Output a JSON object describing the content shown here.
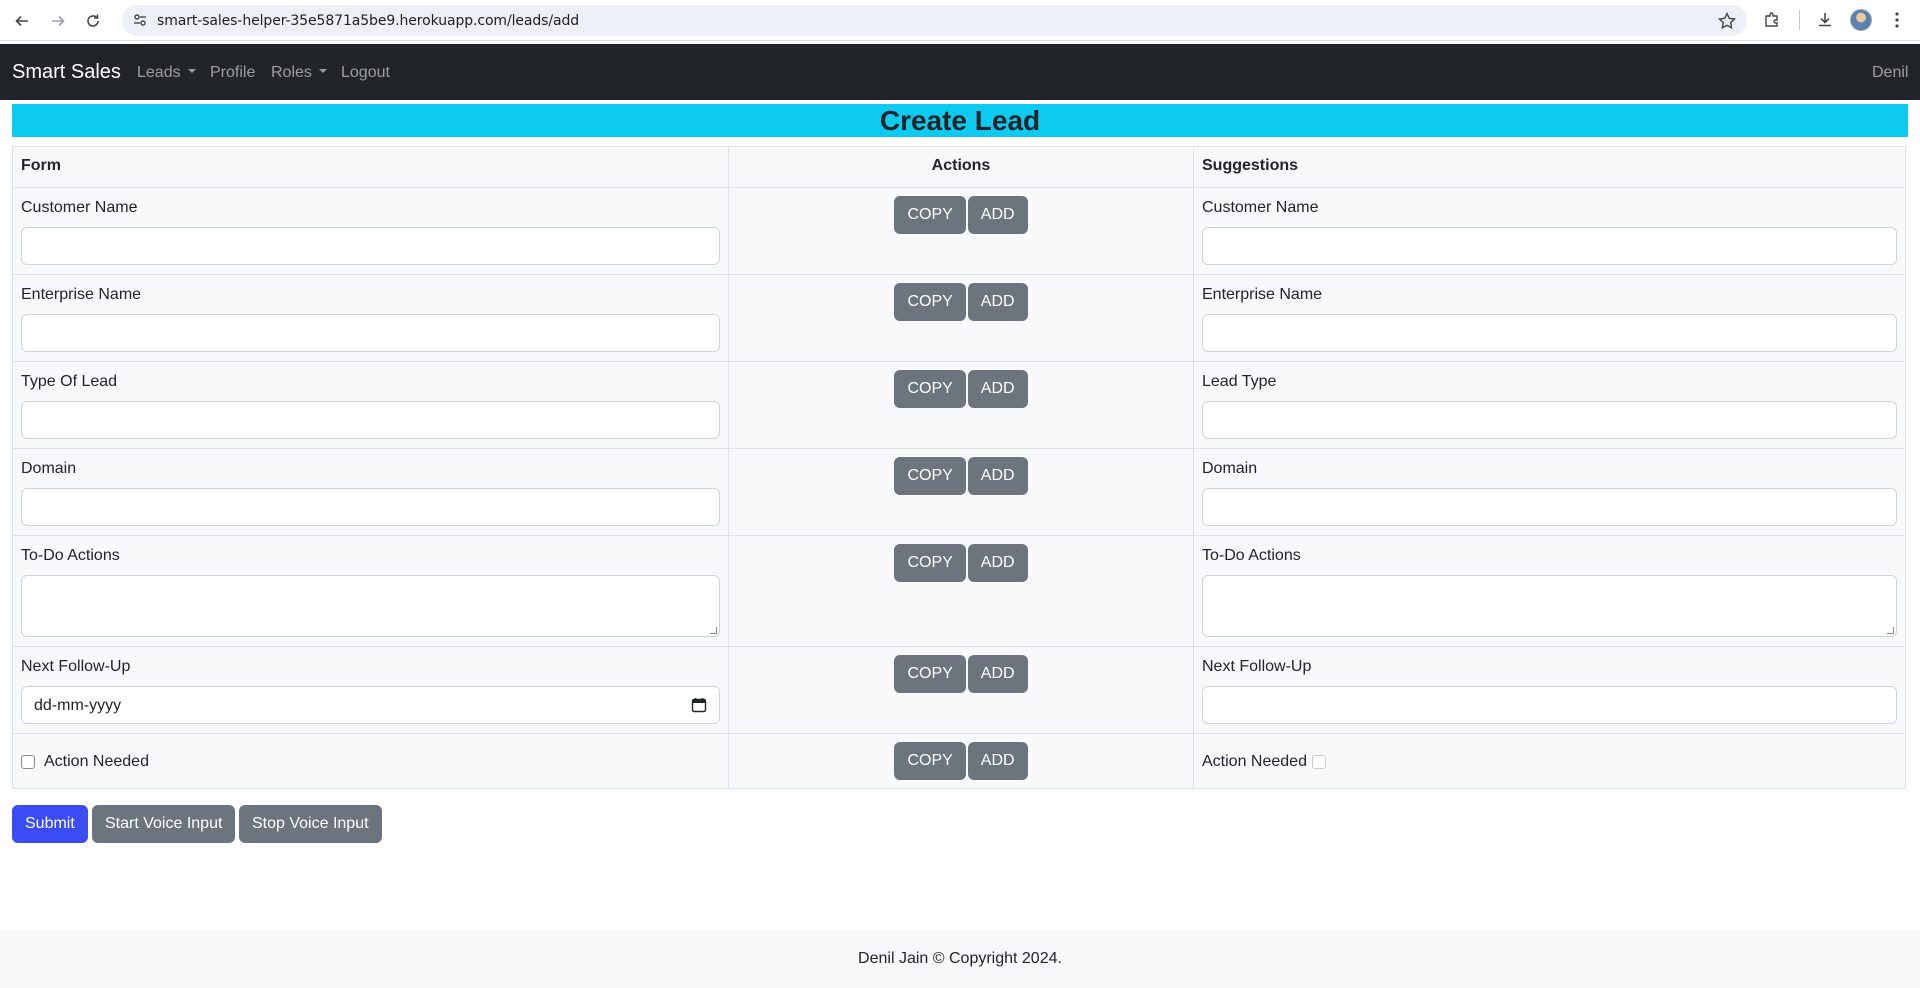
{
  "browser": {
    "url": "smart-sales-helper-35e5871a5be9.herokuapp.com/leads/add"
  },
  "navbar": {
    "brand": "Smart Sales",
    "links": {
      "leads": "Leads",
      "profile": "Profile",
      "roles": "Roles",
      "logout": "Logout"
    },
    "user": "Denil"
  },
  "page": {
    "title": "Create Lead"
  },
  "table": {
    "headers": {
      "form": "Form",
      "actions": "Actions",
      "suggestions": "Suggestions"
    },
    "copy_label": "COPY",
    "add_label": "ADD",
    "rows": [
      {
        "form_label": "Customer Name",
        "suggestion_label": "Customer Name"
      },
      {
        "form_label": "Enterprise Name",
        "suggestion_label": "Enterprise Name"
      },
      {
        "form_label": "Type Of Lead",
        "suggestion_label": "Lead Type"
      },
      {
        "form_label": "Domain",
        "suggestion_label": "Domain"
      },
      {
        "form_label": "To-Do Actions",
        "suggestion_label": "To-Do Actions"
      },
      {
        "form_label": "Next Follow-Up",
        "suggestion_label": "Next Follow-Up",
        "date_placeholder": "dd-mm-yyyy"
      },
      {
        "form_label": "Action Needed",
        "suggestion_label": "Action Needed"
      }
    ]
  },
  "buttons": {
    "submit": "Submit",
    "start_voice": "Start Voice Input",
    "stop_voice": "Stop Voice Input"
  },
  "footer": {
    "text": "Denil Jain © Copyright 2024."
  },
  "colors": {
    "navbar_bg": "#212529",
    "banner_bg": "#0dcaf0",
    "primary": "#3b4cf5",
    "secondary": "#6c757d"
  }
}
